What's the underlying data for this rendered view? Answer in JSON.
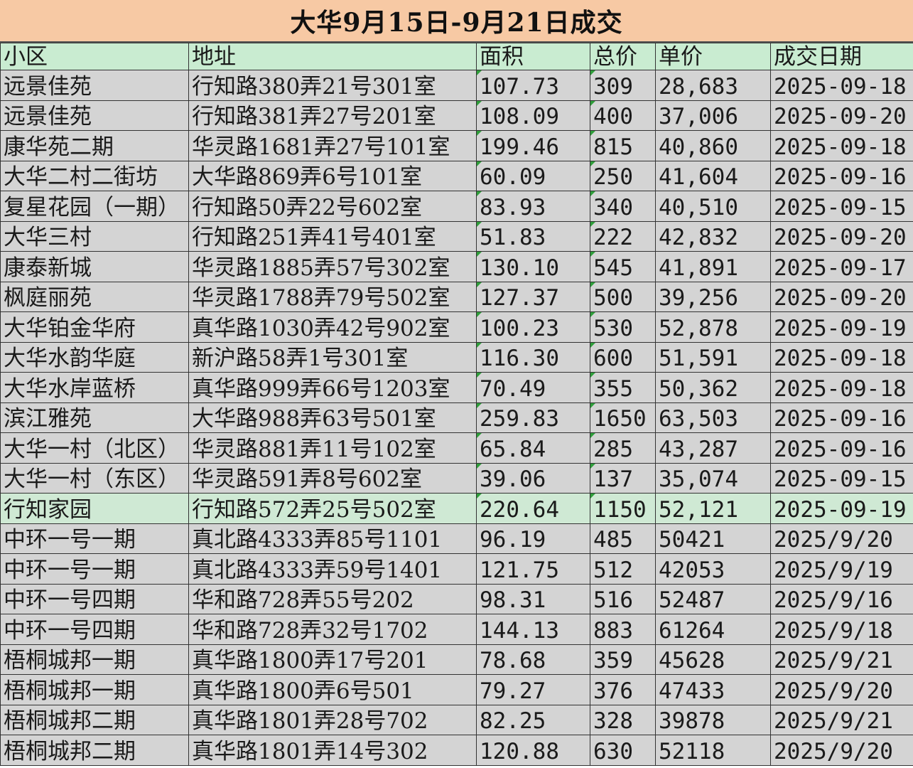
{
  "title": "大华9月15日-9月21日成交",
  "headers": {
    "name": "小区",
    "address": "地址",
    "area": "面积",
    "total": "总价",
    "unit": "单价",
    "date": "成交日期"
  },
  "rows": [
    {
      "name": "远景佳苑",
      "address": "行知路380弄21号301室",
      "area": "107.73",
      "total": "309",
      "unit": "28,683",
      "date": "2025-09-18"
    },
    {
      "name": "远景佳苑",
      "address": "行知路381弄27号201室",
      "area": "108.09",
      "total": "400",
      "unit": "37,006",
      "date": "2025-09-20"
    },
    {
      "name": "康华苑二期",
      "address": "华灵路1681弄27号101室",
      "area": "199.46",
      "total": "815",
      "unit": "40,860",
      "date": "2025-09-18"
    },
    {
      "name": "大华二村二街坊",
      "address": "大华路869弄6号101室",
      "area": "60.09",
      "total": "250",
      "unit": "41,604",
      "date": "2025-09-16"
    },
    {
      "name": "复星花园（一期）",
      "address": "行知路50弄22号602室",
      "area": "83.93",
      "total": "340",
      "unit": "40,510",
      "date": "2025-09-15"
    },
    {
      "name": "大华三村",
      "address": "行知路251弄41号401室",
      "area": "51.83",
      "total": "222",
      "unit": "42,832",
      "date": "2025-09-20"
    },
    {
      "name": "康泰新城",
      "address": "华灵路1885弄57号302室",
      "area": "130.10",
      "total": "545",
      "unit": "41,891",
      "date": "2025-09-17"
    },
    {
      "name": "枫庭丽苑",
      "address": "华灵路1788弄79号502室",
      "area": "127.37",
      "total": "500",
      "unit": "39,256",
      "date": "2025-09-20"
    },
    {
      "name": "大华铂金华府",
      "address": "真华路1030弄42号902室",
      "area": "100.23",
      "total": "530",
      "unit": "52,878",
      "date": "2025-09-19"
    },
    {
      "name": "大华水韵华庭",
      "address": "新沪路58弄1号301室",
      "area": "116.30",
      "total": "600",
      "unit": "51,591",
      "date": "2025-09-18"
    },
    {
      "name": "大华水岸蓝桥",
      "address": "真华路999弄66号1203室",
      "area": "70.49",
      "total": "355",
      "unit": "50,362",
      "date": "2025-09-18"
    },
    {
      "name": "滨江雅苑",
      "address": "大华路988弄63号501室",
      "area": "259.83",
      "total": "1650",
      "unit": "63,503",
      "date": "2025-09-16"
    },
    {
      "name": "大华一村（北区）",
      "address": "华灵路881弄11号102室",
      "area": "65.84",
      "total": "285",
      "unit": "43,287",
      "date": "2025-09-16"
    },
    {
      "name": "大华一村（东区）",
      "address": "华灵路591弄8号602室",
      "area": "39.06",
      "total": "137",
      "unit": "35,074",
      "date": "2025-09-15"
    },
    {
      "name": "行知家园",
      "address": "行知路572弄25号502室",
      "area": "220.64",
      "total": "1150",
      "unit": "52,121",
      "date": "2025-09-19"
    },
    {
      "name": "中环一号一期",
      "address": "真北路4333弄85号1101",
      "area": "96.19",
      "total": "485",
      "unit": "50421",
      "date": "2025/9/20"
    },
    {
      "name": "中环一号一期",
      "address": "真北路4333弄59号1401",
      "area": "121.75",
      "total": "512",
      "unit": "42053",
      "date": "2025/9/19"
    },
    {
      "name": "中环一号四期",
      "address": "华和路728弄55号202",
      "area": "98.31",
      "total": "516",
      "unit": "52487",
      "date": "2025/9/16"
    },
    {
      "name": "中环一号四期",
      "address": "华和路728弄32号1702",
      "area": "144.13",
      "total": "883",
      "unit": "61264",
      "date": "2025/9/18"
    },
    {
      "name": "梧桐城邦一期",
      "address": "真华路1800弄17号201",
      "area": "78.68",
      "total": "359",
      "unit": "45628",
      "date": "2025/9/21"
    },
    {
      "name": "梧桐城邦一期",
      "address": "真华路1800弄6号501",
      "area": "79.27",
      "total": "376",
      "unit": "47433",
      "date": "2025/9/20"
    },
    {
      "name": "梧桐城邦二期",
      "address": "真华路1801弄28号702",
      "area": "82.25",
      "total": "328",
      "unit": "39878",
      "date": "2025/9/21"
    },
    {
      "name": "梧桐城邦二期",
      "address": "真华路1801弄14号302",
      "area": "120.88",
      "total": "630",
      "unit": "52118",
      "date": "2025/9/20"
    }
  ],
  "colors": {
    "title_bg": "#f7c9a4",
    "header_bg": "#c9ecd1",
    "row_bg": "#d4d4d4",
    "row_highlight": "#cfe9d4",
    "number_marker": "#2e9e3a"
  }
}
